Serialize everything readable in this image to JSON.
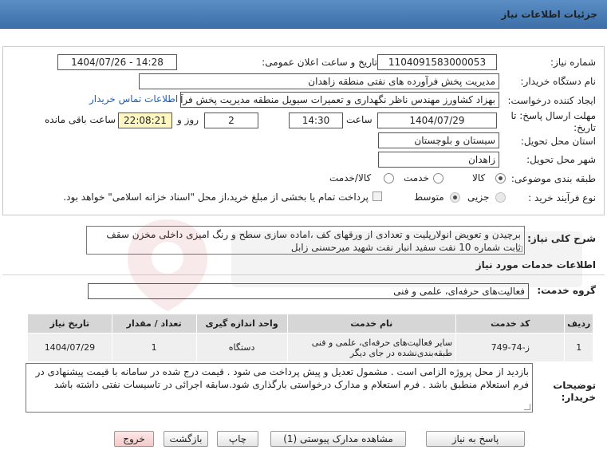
{
  "header": {
    "title": "جزئیات اطلاعات نیاز"
  },
  "fields": {
    "need_number_label": "شماره نیاز:",
    "need_number": "1104091583000053",
    "announce_label": "تاریخ و ساعت اعلان عمومی:",
    "announce_value": "1404/07/26 - 14:28",
    "buyer_org_label": "نام دستگاه خریدار:",
    "buyer_org": "مدیریت پخش فرآورده های نفتی منطقه زاهدان",
    "creator_label": "ایجاد کننده درخواست:",
    "creator": "بهزاد کشاورز مهندس ناظر نگهداری و تعمیرات سیویل منطقه  مدیریت پخش فرآورده",
    "contact_link": "اطلاعات تماس خریدار",
    "deadline_label_1": "مهلت ارسال پاسخ: تا",
    "deadline_label_2": "تاریخ:",
    "deadline_date": "1404/07/29",
    "time_label": "ساعت",
    "deadline_time": "14:30",
    "days": "2",
    "days_label": "روز و",
    "remaining": "22:08:21",
    "remaining_label": "ساعت باقی مانده",
    "province_label": "استان محل تحویل:",
    "province": "سیستان و بلوچستان",
    "city_label": "شهر محل تحویل:",
    "city": "زاهدان",
    "category_label": "طبقه بندی موضوعی:",
    "category_options": [
      "کالا",
      "خدمت",
      "کالا/خدمت"
    ],
    "process_label": "نوع فرآیند خرید :",
    "process_options": [
      "جزیی",
      "متوسط"
    ],
    "payment_note": "پرداخت تمام یا بخشی از مبلغ خرید،از محل \"اسناد خزانه اسلامی\" خواهد بود."
  },
  "description": {
    "label": "شرح کلی نیاز:",
    "text": "برچیدن و تعویض انولارپلیت و تعدادی از ورقهای کف ،اماده سازی سطح و رنگ امیزی داخلی مخزن سقف ثابت شماره 10 نفت سفید انبار نفت شهید میرحسنی زابل"
  },
  "services": {
    "section_title": "اطلاعات خدمات مورد نیاز",
    "group_label": "گروه خدمت:",
    "group_value": "فعالیت‌های حرفه‌ای، علمی و فنی",
    "table": {
      "headers": [
        "ردیف",
        "کد خدمت",
        "نام خدمت",
        "واحد اندازه گیری",
        "تعداد / مقدار",
        "تاریخ نیاز"
      ],
      "rows": [
        [
          "1",
          "ز-74-749",
          "سایر فعالیت‌های حرفه‌ای، علمی و فنی طبقه‌بندی‌نشده در جای دیگر",
          "دستگاه",
          "1",
          "1404/07/29"
        ]
      ]
    }
  },
  "buyer_notes": {
    "label": "توضیحات خریدار:",
    "text": "بازدید از محل پروژه الزامی است . مشمول تعدیل و پیش پرداخت می شود . قیمت درج شده در سامانه با قیمت پیشنهادی در فرم استعلام منطبق باشد . فرم استعلام و مدارک درخواستی بارگذاری شود.سابقه اجرائی در تاسیسات نفتی داشته باشد"
  },
  "buttons": {
    "reply": "پاسخ به نیاز",
    "attachments": "مشاهده مدارک پیوستی (1)",
    "print": "چاپ",
    "back": "بازگشت",
    "exit": "خروج"
  },
  "colors": {
    "header": "#4a7fba",
    "link": "#1f5fb3",
    "highlight": "#fff7c2"
  }
}
